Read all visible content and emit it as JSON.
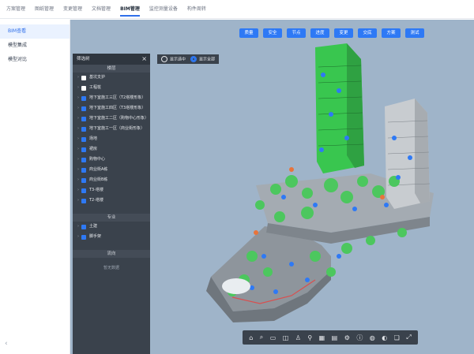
{
  "topnav": {
    "tabs": [
      "方案管理",
      "图纸管理",
      "变更管理",
      "文档管理",
      "BIM管理",
      "监控测量设备",
      "构件周转"
    ],
    "active": "BIM管理"
  },
  "sidebar": {
    "items": [
      "BIM查看",
      "模型集成",
      "模型对比"
    ],
    "active": "BIM查看",
    "collapse_icon": "chevron-left-icon"
  },
  "toolbar": {
    "buttons": [
      "质量",
      "安全",
      "节点",
      "进度",
      "变更",
      "交底",
      "方案",
      "测试"
    ]
  },
  "display_toggle": {
    "options": [
      {
        "label": "显示选中",
        "selected": false
      },
      {
        "label": "显示全部",
        "selected": true
      }
    ]
  },
  "filter_panel": {
    "title": "筛选树",
    "close_icon": "close-icon",
    "section_floor": "楼层",
    "floors": [
      {
        "label": "基坑支护",
        "checked": false
      },
      {
        "label": "工程桩",
        "checked": false
      },
      {
        "label": "地下室施工三区（T2塔楼形象）",
        "checked": true
      },
      {
        "label": "地下室施工四区（T3塔楼形象）",
        "checked": true
      },
      {
        "label": "地下室施工二区（购物中心形象）",
        "checked": true
      },
      {
        "label": "地下室施工一区（商业街形象）",
        "checked": true
      },
      {
        "label": "场地",
        "checked": true
      },
      {
        "label": "裙房",
        "checked": true
      },
      {
        "label": "购物中心",
        "checked": true
      },
      {
        "label": "商业街A栋",
        "checked": true
      },
      {
        "label": "商业街B栋",
        "checked": true
      },
      {
        "label": "T3-塔楼",
        "checked": true
      },
      {
        "label": "T2-塔楼",
        "checked": true
      }
    ],
    "section_major": "专业",
    "majors": [
      {
        "label": "土建",
        "checked": true
      },
      {
        "label": "脚手架",
        "checked": true
      }
    ],
    "section_flow": "流向",
    "flow_empty": "暂无数据"
  },
  "bottom_tools": [
    "home-icon",
    "search-icon",
    "measure-icon",
    "section-icon",
    "person-icon",
    "pin-icon",
    "grid-icon",
    "chart-icon",
    "gear-icon",
    "info-icon",
    "globe-icon",
    "sphere-icon",
    "layers-icon",
    "fullscreen-icon"
  ],
  "colors": {
    "accent": "#2e79f5",
    "viewport_bg": "#9fb4c9",
    "panel_bg": "#3a424c",
    "model_green": "#3ec95a",
    "model_grey": "#9aa0a6"
  }
}
